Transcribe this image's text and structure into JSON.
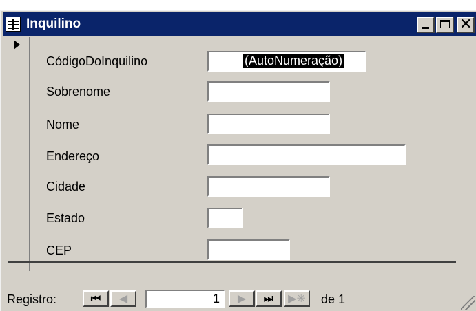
{
  "window": {
    "title": "Inquilino"
  },
  "fields": [
    {
      "label": "CódigoDoInquilino",
      "value": "(AutoNumeração)"
    },
    {
      "label": "Sobrenome",
      "value": ""
    },
    {
      "label": "Nome",
      "value": ""
    },
    {
      "label": "Endereço",
      "value": ""
    },
    {
      "label": "Cidade",
      "value": ""
    },
    {
      "label": "Estado",
      "value": ""
    },
    {
      "label": "CEP",
      "value": ""
    }
  ],
  "navigation": {
    "label": "Registro:",
    "current_record": "1",
    "of_text": "de 1"
  }
}
